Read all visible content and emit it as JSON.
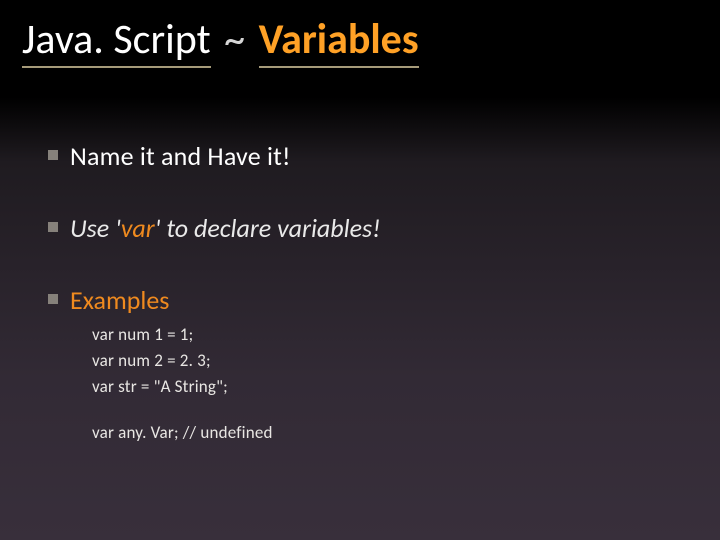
{
  "title": {
    "part_js": "Java. Script",
    "separator": "~",
    "part_topic": "Variables"
  },
  "bullets": [
    {
      "text": "Name it and Have it!"
    },
    {
      "prefix": "Use '",
      "keyword": "var",
      "suffix": "' to declare variables!"
    },
    {
      "heading": "Examples",
      "code": [
        "var num 1 = 1;",
        "var num 2 = 2. 3;",
        "var str = \"A String\";"
      ],
      "code_after_gap": [
        "var any. Var;  // undefined"
      ]
    }
  ]
}
